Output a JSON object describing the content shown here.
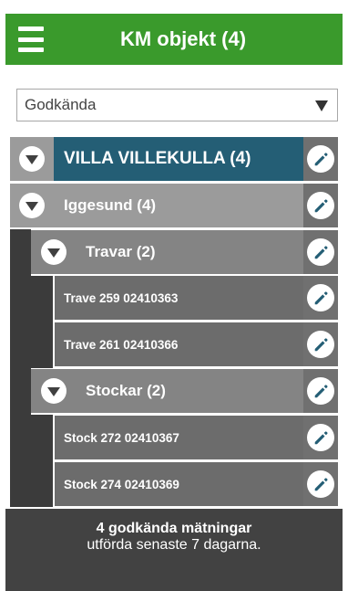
{
  "header": {
    "title": "KM objekt (4)",
    "menu_icon": "hamburger-menu-icon"
  },
  "filter": {
    "selected": "Godkända",
    "icon": "chevron-down-icon"
  },
  "tree": {
    "root": {
      "label": "VILLA VILLEKULLA (4)"
    },
    "site": {
      "label": "Iggesund (4)"
    },
    "group1": {
      "label": "Travar (2)"
    },
    "item1": {
      "label": "Trave 259 02410363"
    },
    "item2": {
      "label": "Trave 261 02410366"
    },
    "group2": {
      "label": "Stockar (2)"
    },
    "item3": {
      "label": "Stock 272 02410367"
    },
    "item4": {
      "label": "Stock 274 02410369"
    },
    "edit_icon": "pencil-icon",
    "toggle_icon": "collapse-triangle-icon"
  },
  "footer": {
    "line1": "4 godkända mätningar",
    "line2": "utförda senaste 7 dagarna."
  },
  "colors": {
    "header_bg": "#3a9a2c",
    "root_bg": "#245e75",
    "site_bg": "#9b9b9b",
    "group_bg": "#848484",
    "item_bg": "#6c6c6c",
    "footer_bg": "#424242"
  }
}
